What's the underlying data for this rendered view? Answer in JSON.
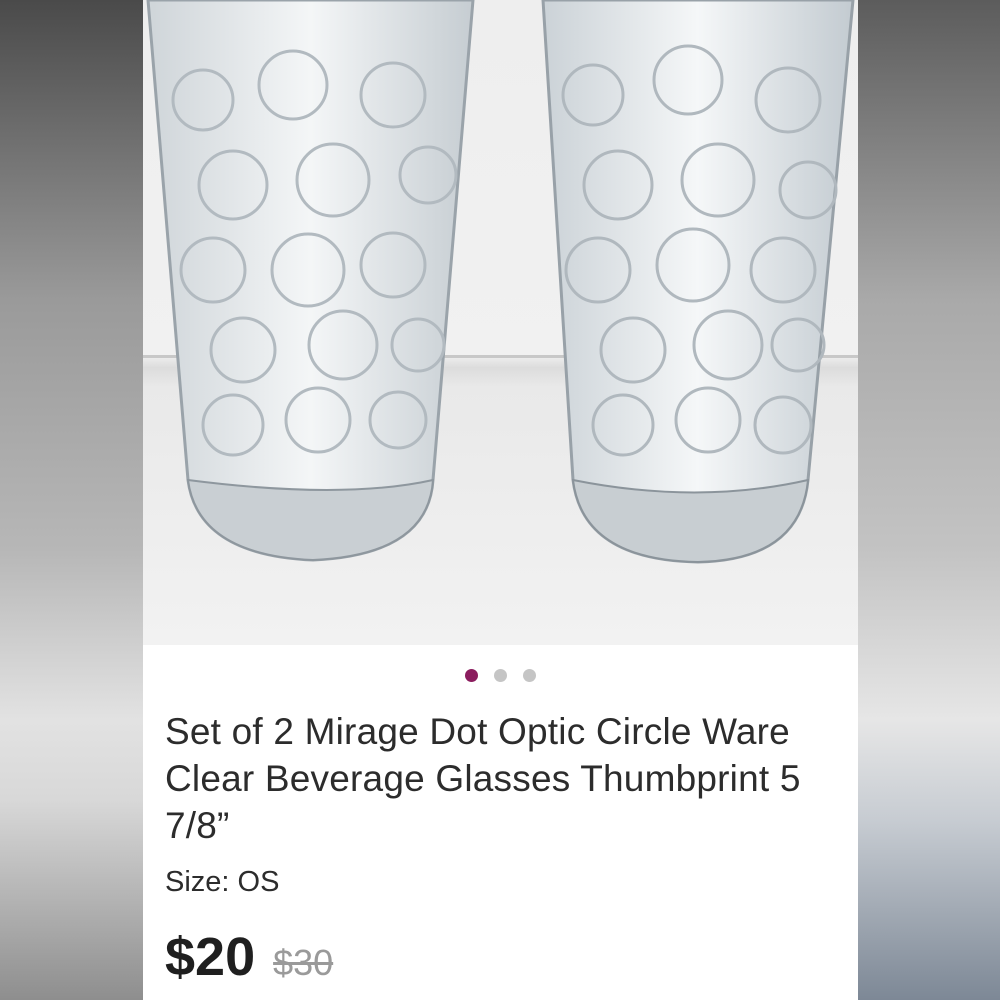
{
  "listing": {
    "carousel": {
      "count": 3,
      "active_index": 0
    },
    "title": "Set of 2 Mirage Dot Optic Circle Ware Clear Beverage Glasses Thumbprint 5 7/8”",
    "size_label": "Size: OS",
    "price": "$20",
    "original_price": "$30"
  },
  "colors": {
    "accent": "#8b1d5e",
    "text": "#2c2c2c",
    "muted": "#9a9a9a"
  },
  "icons": {
    "carousel_dot": "dot-icon"
  }
}
